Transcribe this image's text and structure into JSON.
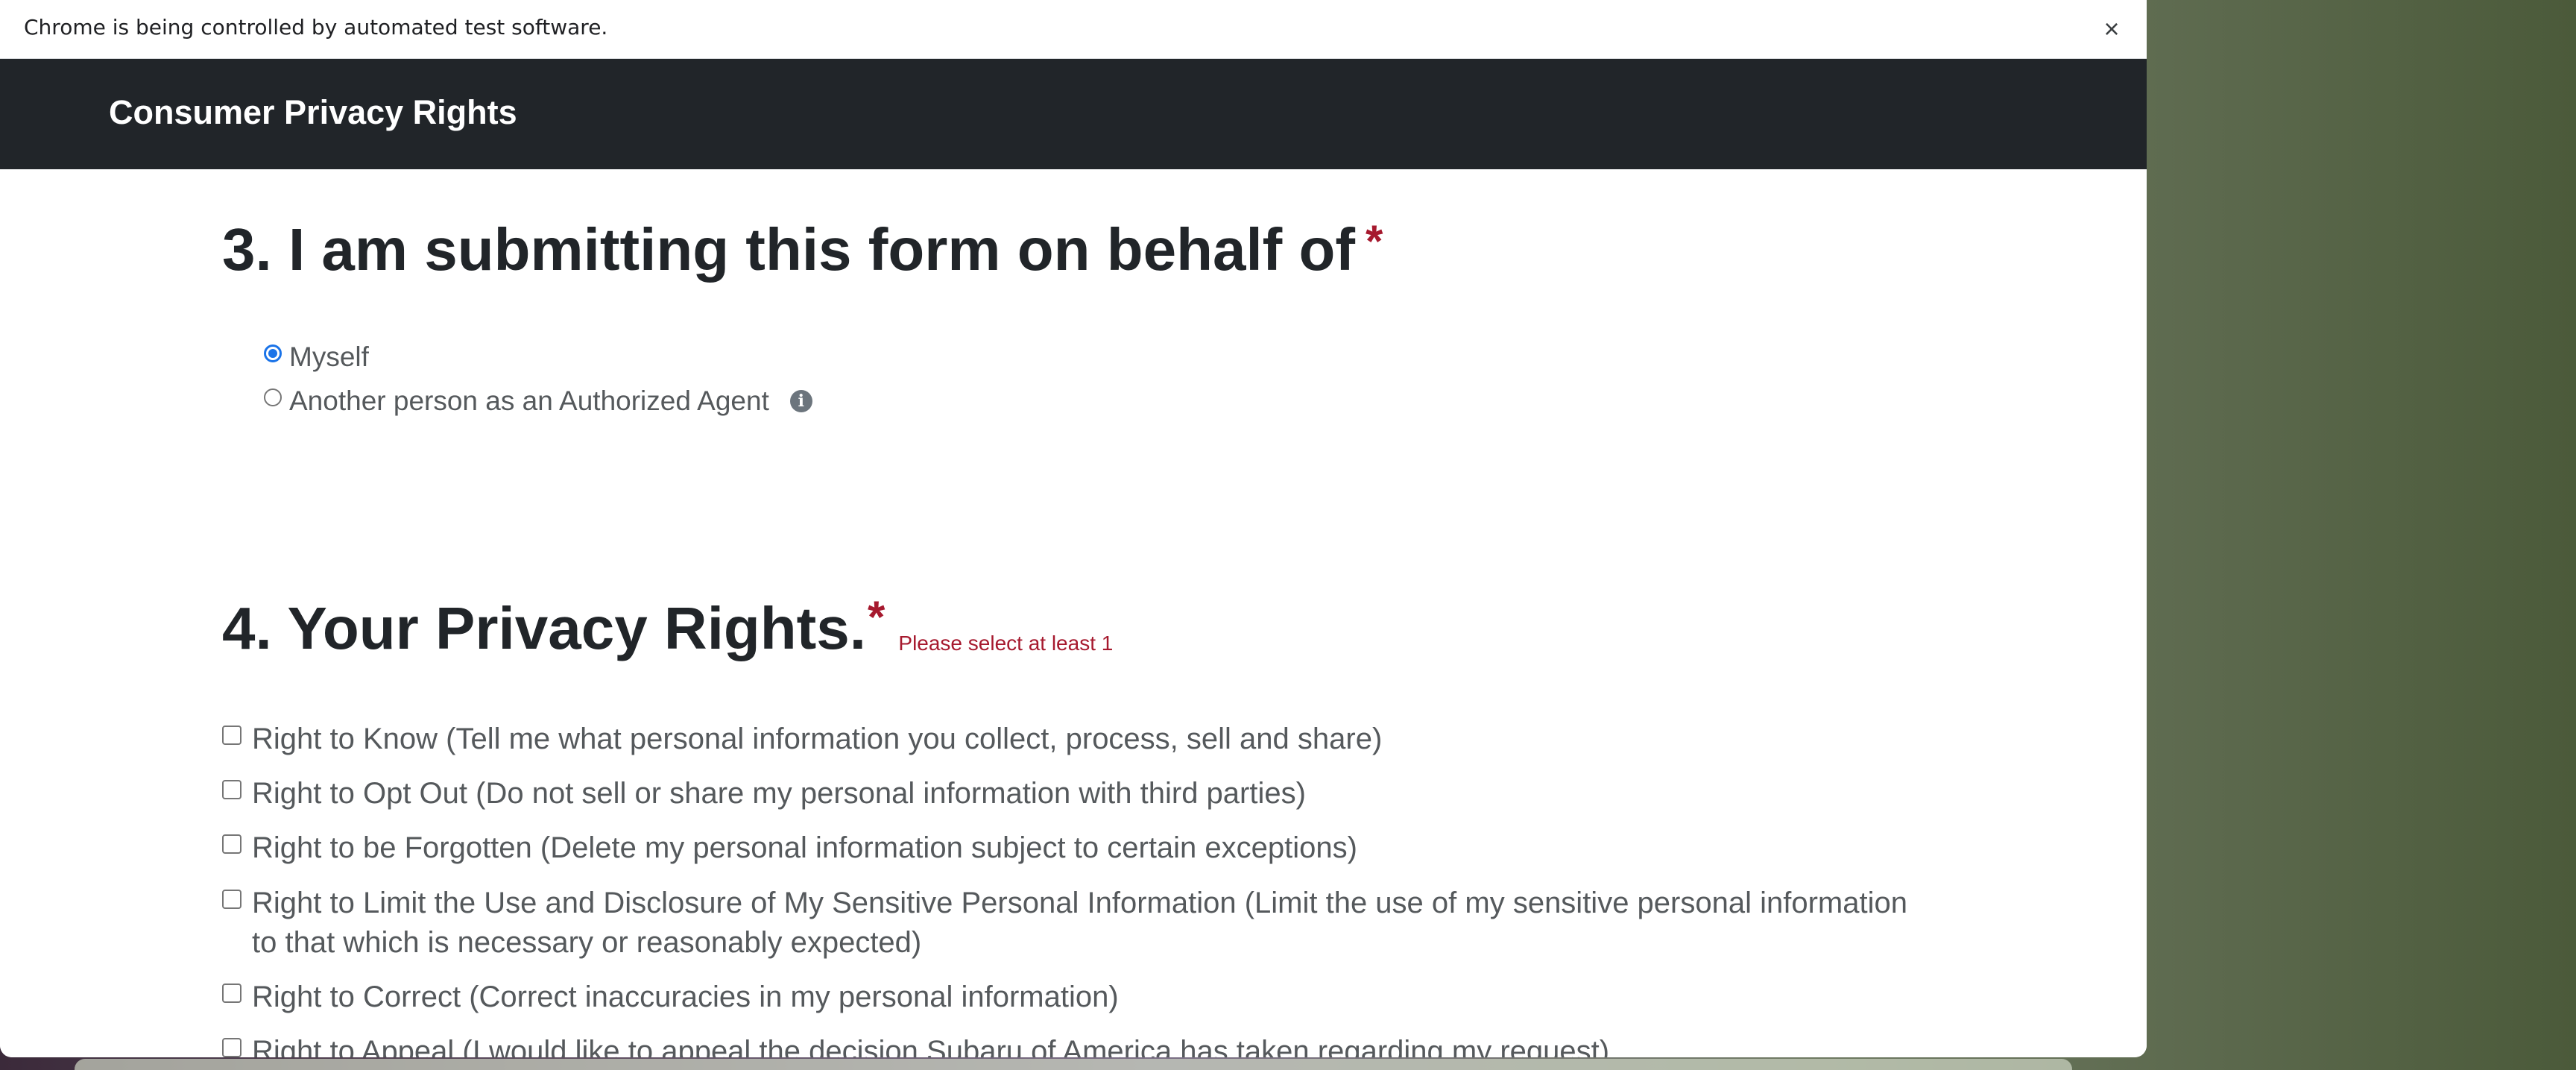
{
  "infobar": {
    "message": "Chrome is being controlled by automated test software.",
    "close_label": "×"
  },
  "header": {
    "title": "Consumer Privacy Rights"
  },
  "question3": {
    "heading": "3. I am submitting this form on behalf of",
    "required_mark": "*",
    "options": [
      {
        "label": "Myself",
        "selected": true
      },
      {
        "label": "Another person as an Authorized Agent",
        "selected": false
      }
    ],
    "info_icon": "info-icon",
    "info_glyph": "i"
  },
  "question4": {
    "heading": "4. Your Privacy Rights.",
    "required_mark": "*",
    "validation": "Please select at least 1",
    "rights": [
      {
        "label": "Right to Know (Tell me what personal information you collect, process, sell and share)",
        "checked": false
      },
      {
        "label": "Right to Opt Out (Do not sell or share my personal information with third parties)",
        "checked": false
      },
      {
        "label": "Right to be Forgotten (Delete my personal information subject to certain exceptions)",
        "checked": false
      },
      {
        "label": "Right to Limit the Use and Disclosure of My Sensitive Personal Information (Limit the use of my sensitive personal information to that which is necessary or reasonably expected)",
        "checked": false
      },
      {
        "label": "Right to Correct (Correct inaccuracies in my personal information)",
        "checked": false
      },
      {
        "label": "Right to Appeal (I would like to appeal the decision Subaru of America has taken regarding my request)",
        "checked": false
      }
    ]
  },
  "colors": {
    "header_bg": "#212529",
    "required": "#a6192e",
    "radio_accent": "#1a73e8",
    "label_text": "#55595c"
  }
}
